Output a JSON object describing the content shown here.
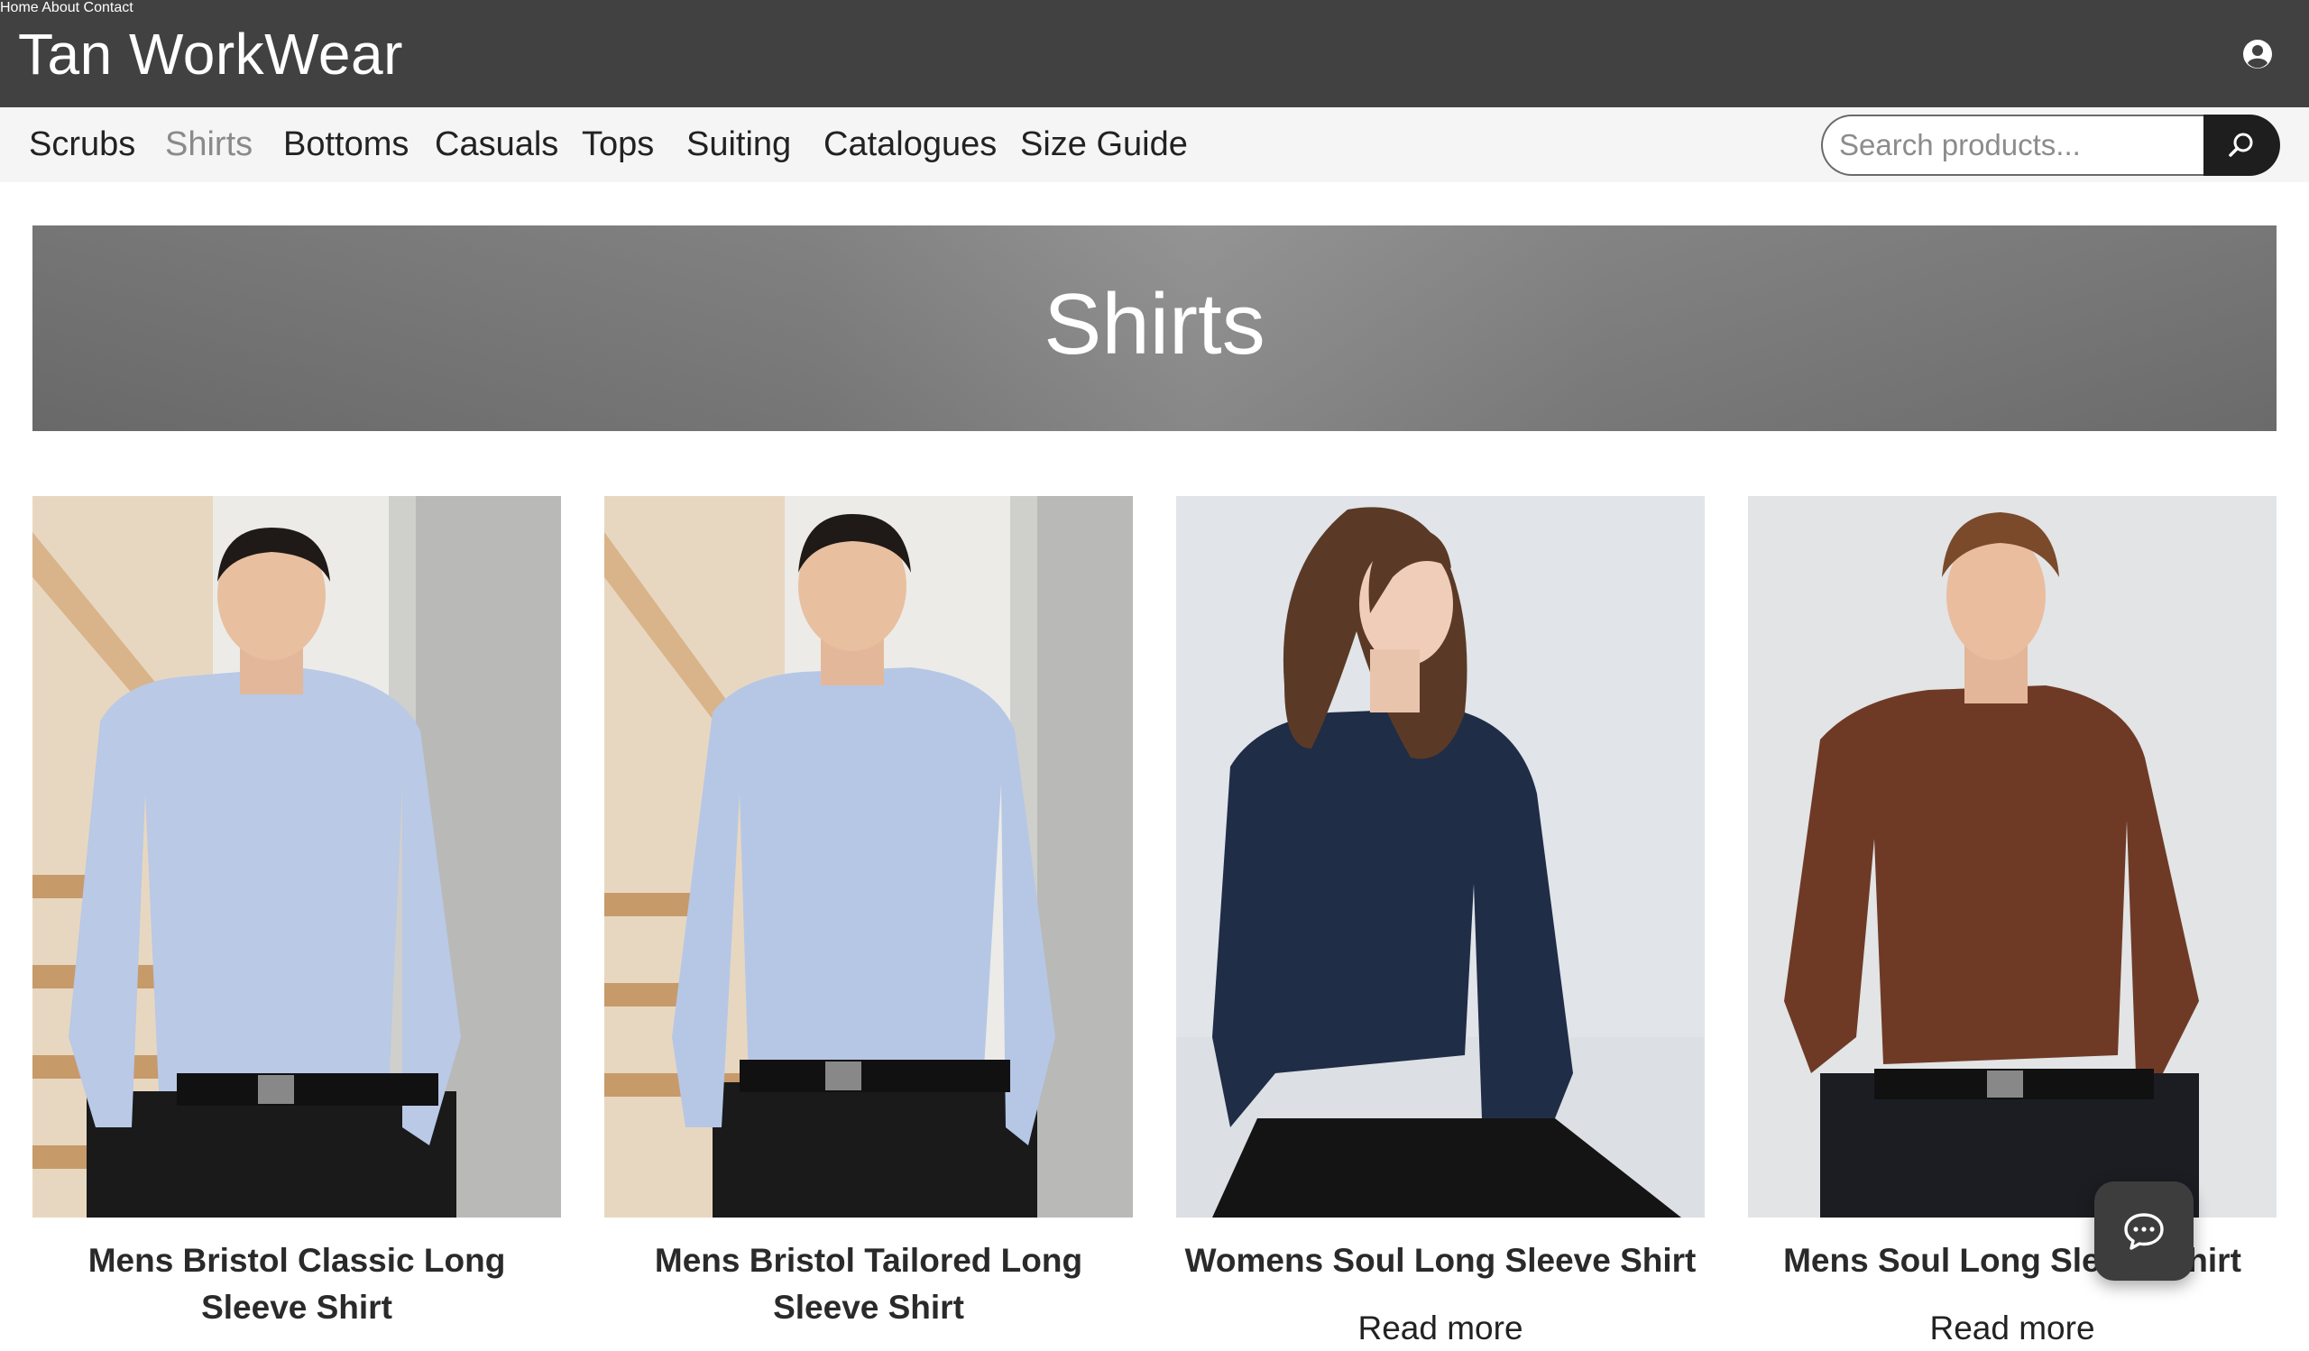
{
  "header": {
    "brand": "Tan WorkWear",
    "nav": [
      {
        "label": "Home"
      },
      {
        "label": "About"
      },
      {
        "label": "Contact"
      }
    ],
    "account_icon": "user-circle-icon"
  },
  "categories": {
    "items": [
      {
        "label": "Scrubs"
      },
      {
        "label": "Shirts",
        "active": true
      },
      {
        "label": "Bottoms"
      },
      {
        "label": "Casuals"
      },
      {
        "label": "Tops"
      },
      {
        "label": "Suiting"
      },
      {
        "label": "Catalogues"
      },
      {
        "label": "Size Guide"
      }
    ]
  },
  "search": {
    "placeholder": "Search products...",
    "value": "",
    "icon": "search-icon"
  },
  "hero": {
    "title": "Shirts"
  },
  "products": [
    {
      "name": "Mens Bristol Classic Long Sleeve Shirt",
      "shirt_color": "#b9c9e6",
      "action": ""
    },
    {
      "name": "Mens Bristol Tailored Long Sleeve Shirt",
      "shirt_color": "#b6c7e6",
      "action": ""
    },
    {
      "name": "Womens Soul Long Sleeve Shirt",
      "shirt_color": "#1f2d47",
      "action": "Read more"
    },
    {
      "name": "Mens Soul Long Sleeve Shirt",
      "shirt_color": "#6e3a26",
      "action": "Read more"
    }
  ],
  "chat": {
    "icon": "chat-bubble-icon"
  },
  "colors": {
    "header_bg": "#414141",
    "catbar_bg": "#f5f5f5",
    "active_category": "#8a8a8a",
    "search_button": "#1e1e1e"
  }
}
